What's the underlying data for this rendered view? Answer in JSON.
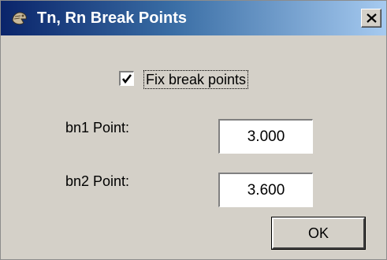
{
  "window": {
    "title": "Tn, Rn Break Points",
    "title_icon": "app-icon",
    "close_icon": "close-icon"
  },
  "options": {
    "fix_break_points_label": "Fix break points",
    "fix_break_points_checked": true
  },
  "fields": {
    "bn1_label": "bn1 Point:",
    "bn1_value": "3.000",
    "bn2_label": "bn2 Point:",
    "bn2_value": "3.600"
  },
  "buttons": {
    "ok_label": "OK"
  },
  "colors": {
    "titlebar_start": "#0a246a",
    "titlebar_end": "#a6caf0",
    "face": "#d4d0c8"
  }
}
